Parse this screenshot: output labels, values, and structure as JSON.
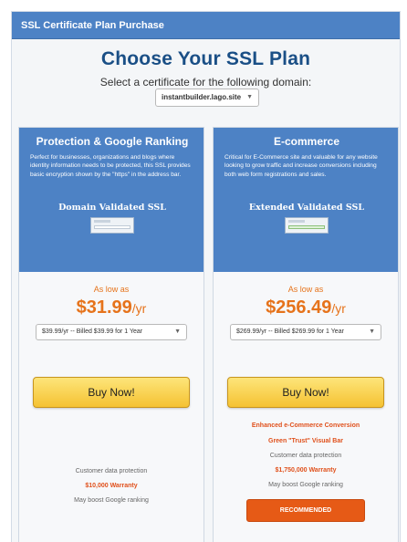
{
  "panel": {
    "header": "SSL Certificate Plan Purchase"
  },
  "page": {
    "title": "Choose Your SSL Plan",
    "subtitle": "Select a certificate for the following domain:",
    "domain_select": "instantbuilder.lago.site"
  },
  "plans": [
    {
      "title": "Protection & Google Ranking",
      "description": "Perfect for businesses, organizations and blogs where identity information needs to be protected, this SSL provides basic encryption shown by the \"https\" in the address bar.",
      "ssl_type": "Domain Validated SSL",
      "as_low_as": "As low as",
      "price": "$31.99",
      "per": "/yr",
      "billing_option": "$39.99/yr -- Billed $39.99 for 1 Year",
      "buy_label": "Buy Now!",
      "features": [
        "Customer data protection",
        "$10,000 Warranty",
        "May boost Google ranking"
      ]
    },
    {
      "title": "E-commerce",
      "description": "Critical for E-Commerce site and valuable for any website looking to grow traffic and increase conversions including both web form registrations and sales.",
      "ssl_type": "Extended Validated SSL",
      "as_low_as": "As low as",
      "price": "$256.49",
      "per": "/yr",
      "billing_option": "$269.99/yr -- Billed $269.99 for 1 Year",
      "buy_label": "Buy Now!",
      "extra_features": [
        "Enhanced e-Commerce Conversion",
        "Green \"Trust\" Visual Bar"
      ],
      "features": [
        "Customer data protection",
        "$1,750,000 Warranty",
        "May boost Google ranking"
      ],
      "badge": "RECOMMENDED"
    }
  ],
  "colors": {
    "header_blue": "#4d82c5",
    "title_blue": "#1a4f86",
    "price_orange": "#e6731b",
    "recommended_orange": "#e65a16",
    "buy_yellow": "#f5c232"
  }
}
